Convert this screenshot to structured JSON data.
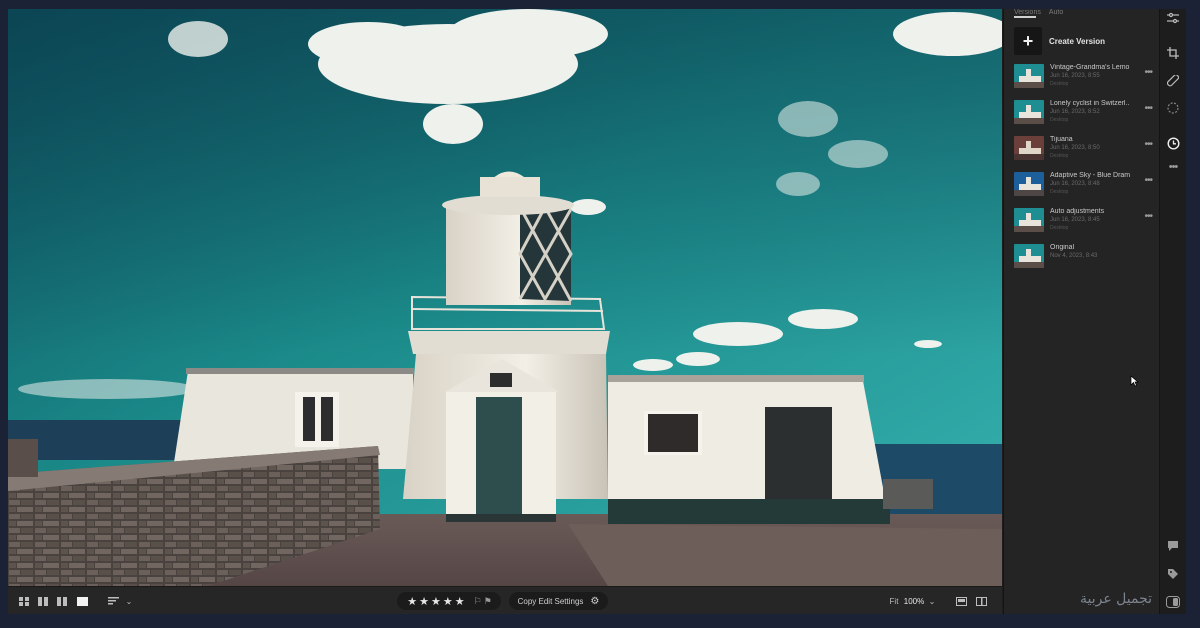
{
  "panel": {
    "tabs": [
      "Versions",
      "Auto"
    ],
    "create_label": "Create Version",
    "versions": [
      {
        "name": "Vintage-Grandma's Lemo...",
        "date": "Jun 16, 2023, 8:55",
        "author": "Desktop",
        "thumb": "teal"
      },
      {
        "name": "Lonely cyclist in Switzerl...",
        "date": "Jun 16, 2023, 8:52",
        "author": "Desktop",
        "thumb": "teal"
      },
      {
        "name": "Tijuana",
        "date": "Jun 16, 2023, 8:50",
        "author": "Desktop",
        "thumb": "warm"
      },
      {
        "name": "Adaptive Sky - Blue Drama",
        "date": "Jun 16, 2023, 8:48",
        "author": "Desktop",
        "thumb": "blue"
      },
      {
        "name": "Auto adjustments",
        "date": "Jun 16, 2023, 8:45",
        "author": "Desktop",
        "thumb": "teal"
      },
      {
        "name": "Original",
        "date": "Nov 4, 2023, 8:43",
        "author": "",
        "thumb": "teal"
      }
    ]
  },
  "rail_icons": [
    "edit-sliders-icon",
    "crop-icon",
    "healing-icon",
    "masking-icon",
    "versions-history-icon",
    "more-icon",
    "comment-icon",
    "tag-icon"
  ],
  "toolbar": {
    "rating_stars": 5,
    "copy_label": "Copy Edit Settings",
    "fit_label": "Fit",
    "zoom_value": "100%"
  },
  "watermark": "تجميل عربية",
  "colors": {
    "accent": "#d0d0d0",
    "app_bg": "#1e1e1e",
    "panel_bg": "#242424"
  }
}
